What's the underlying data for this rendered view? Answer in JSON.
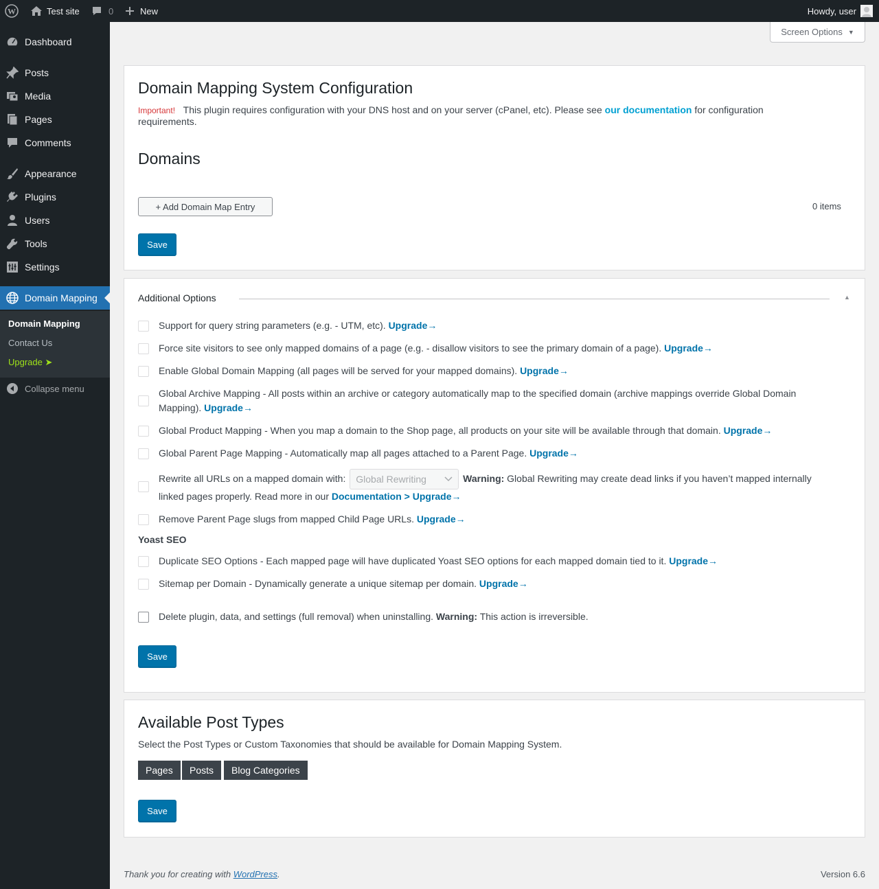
{
  "adminbar": {
    "site_name": "Test site",
    "comments_count": "0",
    "new_label": "New",
    "greeting": "Howdy, user"
  },
  "sidebar": {
    "items": [
      {
        "label": "Dashboard",
        "icon": "dashboard-icon"
      },
      {
        "label": "Posts",
        "icon": "pin-icon"
      },
      {
        "label": "Media",
        "icon": "media-icon"
      },
      {
        "label": "Pages",
        "icon": "pages-icon"
      },
      {
        "label": "Comments",
        "icon": "comments-icon"
      },
      {
        "label": "Appearance",
        "icon": "brush-icon"
      },
      {
        "label": "Plugins",
        "icon": "plugin-icon"
      },
      {
        "label": "Users",
        "icon": "user-icon"
      },
      {
        "label": "Tools",
        "icon": "wrench-icon"
      },
      {
        "label": "Settings",
        "icon": "settings-icon"
      },
      {
        "label": "Domain Mapping",
        "icon": "globe-icon"
      }
    ],
    "submenu": [
      {
        "label": "Domain Mapping"
      },
      {
        "label": "Contact Us"
      },
      {
        "label": "Upgrade ➤"
      }
    ],
    "collapse_label": "Collapse menu"
  },
  "screen_options": "Screen Options",
  "config": {
    "title": "Domain Mapping System Configuration",
    "important_label": "Important!",
    "notice_before": "This plugin requires configuration with your DNS host and on your server (cPanel, etc). Please see",
    "notice_link": "our documentation",
    "notice_after": "for configuration",
    "notice_line2": "requirements.",
    "domains_heading": "Domains",
    "add_entry_label": "+ Add Domain Map Entry",
    "items_count": "0 items",
    "save_label": "Save"
  },
  "additional": {
    "heading": "Additional Options",
    "upgrade_label": "Upgrade→",
    "options": [
      "Support for query string parameters (e.g. - UTM, etc).",
      "Force site visitors to see only mapped domains of a page (e.g. - disallow visitors to see the primary domain of a page).",
      "Enable Global Domain Mapping (all pages will be served for your mapped domains).",
      "Global Archive Mapping - All posts within an archive or category automatically map to the specified domain (archive mappings override Global Domain",
      "Mapping).",
      "Global Product Mapping - When you map a domain to the Shop page, all products on your site will be available through that domain.",
      "Global Parent Page Mapping - Automatically map all pages attached to a Parent Page."
    ],
    "rewrite": {
      "before": "Rewrite all URLs on a mapped domain with:",
      "select_value": "Global Rewriting",
      "warning_label": "Warning:",
      "warning_text": "Global Rewriting may create dead links if you haven’t mapped internally",
      "line2": "linked pages properly. Read more in our",
      "doc_link": "Documentation > Upgrade→"
    },
    "remove_slugs": "Remove Parent Page slugs from mapped Child Page URLs.",
    "yoast_heading": "Yoast SEO",
    "yoast_options": [
      "Duplicate SEO Options - Each mapped page will have duplicated Yoast SEO options for each mapped domain tied to it.",
      "Sitemap per Domain - Dynamically generate a unique sitemap per domain."
    ],
    "delete_text": "Delete plugin, data, and settings (full removal) when uninstalling.",
    "delete_warning_label": "Warning:",
    "delete_warning_text": "This action is irreversible.",
    "save_label": "Save"
  },
  "post_types": {
    "title": "Available Post Types",
    "description": "Select the Post Types or Custom Taxonomies that should be available for Domain Mapping System.",
    "tags": [
      "Pages",
      "Posts",
      "Blog Categories"
    ],
    "save_label": "Save"
  },
  "footer": {
    "thanks_before": "Thank you for creating with",
    "thanks_link": "WordPress",
    "thanks_after": ".",
    "version": "Version 6.6"
  },
  "colors": {
    "admin_dark": "#1d2327",
    "accent": "#2271b1",
    "button_primary": "#0073aa",
    "upgrade_green": "#9fe21a",
    "important_red": "#d63638"
  }
}
